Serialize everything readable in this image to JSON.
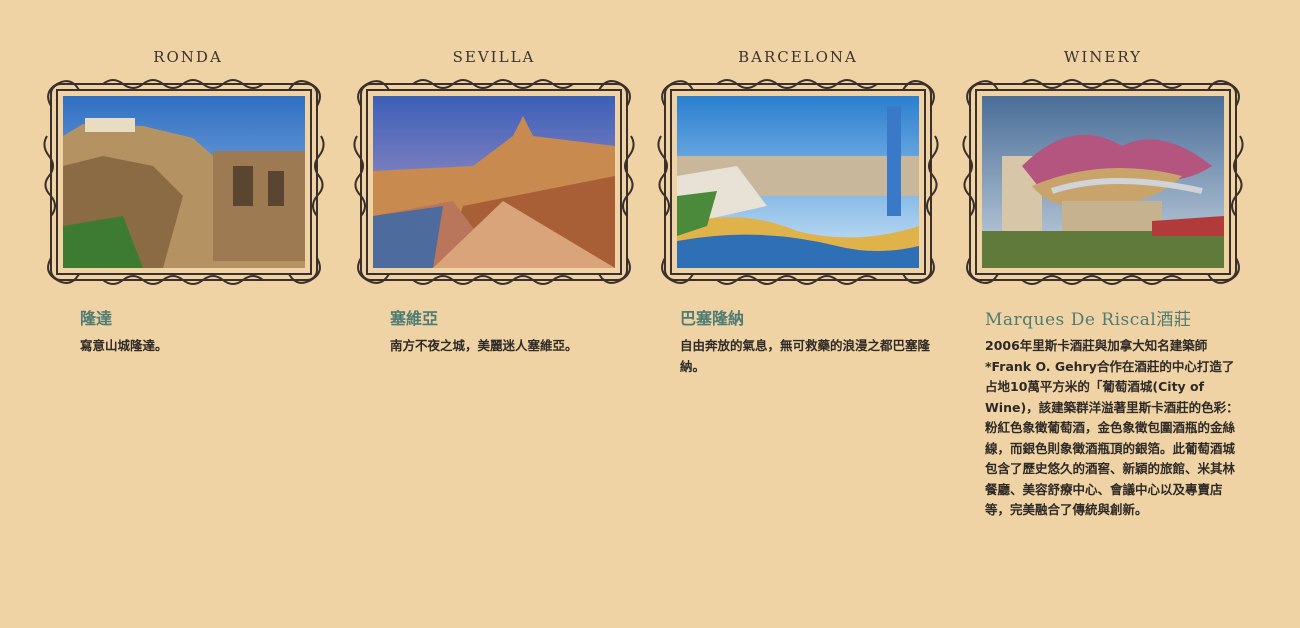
{
  "cards": [
    {
      "label": "RONDA",
      "title": "隆達",
      "description": "寫意山城隆達。",
      "image": "ronda-cliff-bridge"
    },
    {
      "label": "SEVILLA",
      "title": "塞維亞",
      "description": "南方不夜之城，美麗迷人塞維亞。",
      "image": "sevilla-plaza-de-espana"
    },
    {
      "label": "BARCELONA",
      "title": "巴塞隆納",
      "description": "自由奔放的氣息，無可救藥的浪漫之都巴塞隆納。",
      "image": "barcelona-park-guell"
    },
    {
      "label": "WINERY",
      "title": "Marques De Riscal酒莊",
      "description": "2006年里斯卡酒莊與加拿大知名建築師*Frank O. Gehry合作在酒莊的中心打造了占地10萬平方米的「葡萄酒城(City of Wine)，該建築群洋溢著里斯卡酒莊的色彩：粉紅色象徵葡萄酒，金色象徵包圍酒瓶的金絲線，而銀色則象徵酒瓶頂的銀箔。此葡萄酒城包含了歷史悠久的酒窖、新穎的旅館、米其林餐廳、美容舒療中心、會議中心以及專賣店等，完美融合了傳統與創新。",
      "image": "winery-gehry-building"
    }
  ],
  "colors": {
    "background": "#f0d3a4",
    "title": "#4e7b73",
    "text": "#2e2a27",
    "frame": "#3a2f2a"
  }
}
